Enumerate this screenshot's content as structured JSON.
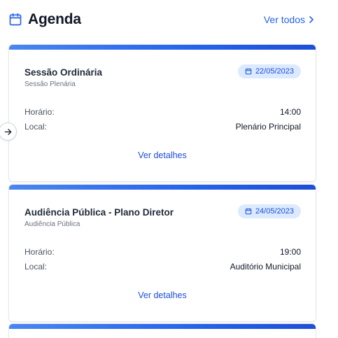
{
  "header": {
    "title": "Agenda",
    "see_all_label": "Ver todos",
    "icon": "calendar-icon",
    "accent": "#2563eb"
  },
  "events": [
    {
      "title": "Sessão Ordinária",
      "subtitle": "Sessão Plenária",
      "date": "22/05/2023",
      "time_label": "Horário:",
      "time": "14:00",
      "location_label": "Local:",
      "location": "Plenário Principal",
      "details_label": "Ver detalhes"
    },
    {
      "title": "Audiência Pública - Plano Diretor",
      "subtitle": "Audiência Pública",
      "date": "24/05/2023",
      "time_label": "Horário:",
      "time": "19:00",
      "location_label": "Local:",
      "location": "Auditório Municipal",
      "details_label": "Ver detalhes"
    }
  ],
  "nav": {
    "icon": "arrow-right-icon"
  },
  "colors": {
    "badge_bg": "#dbeafe",
    "badge_text": "#1d4ed8",
    "bar_start": "#4a86f0",
    "bar_end": "#1d4fd8"
  }
}
